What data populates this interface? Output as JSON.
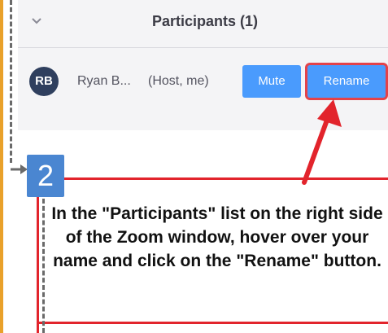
{
  "panel": {
    "title": "Participants (1)",
    "collapse_icon": "chevron-down-icon"
  },
  "participant": {
    "initials": "RB",
    "name": "Ryan B...",
    "role": "(Host, me)",
    "mute_label": "Mute",
    "rename_label": "Rename",
    "avatar_color": "#2f3f5e",
    "button_color": "#2d8cff"
  },
  "step": {
    "number": "2",
    "instruction": "In the \"Participants\" list on the right side of the Zoom window, hover over your name and click on the \"Rename\" button."
  },
  "colors": {
    "highlight": "#e2242c",
    "step_box": "#4a86d1",
    "accent_bar": "#e9a12a"
  }
}
